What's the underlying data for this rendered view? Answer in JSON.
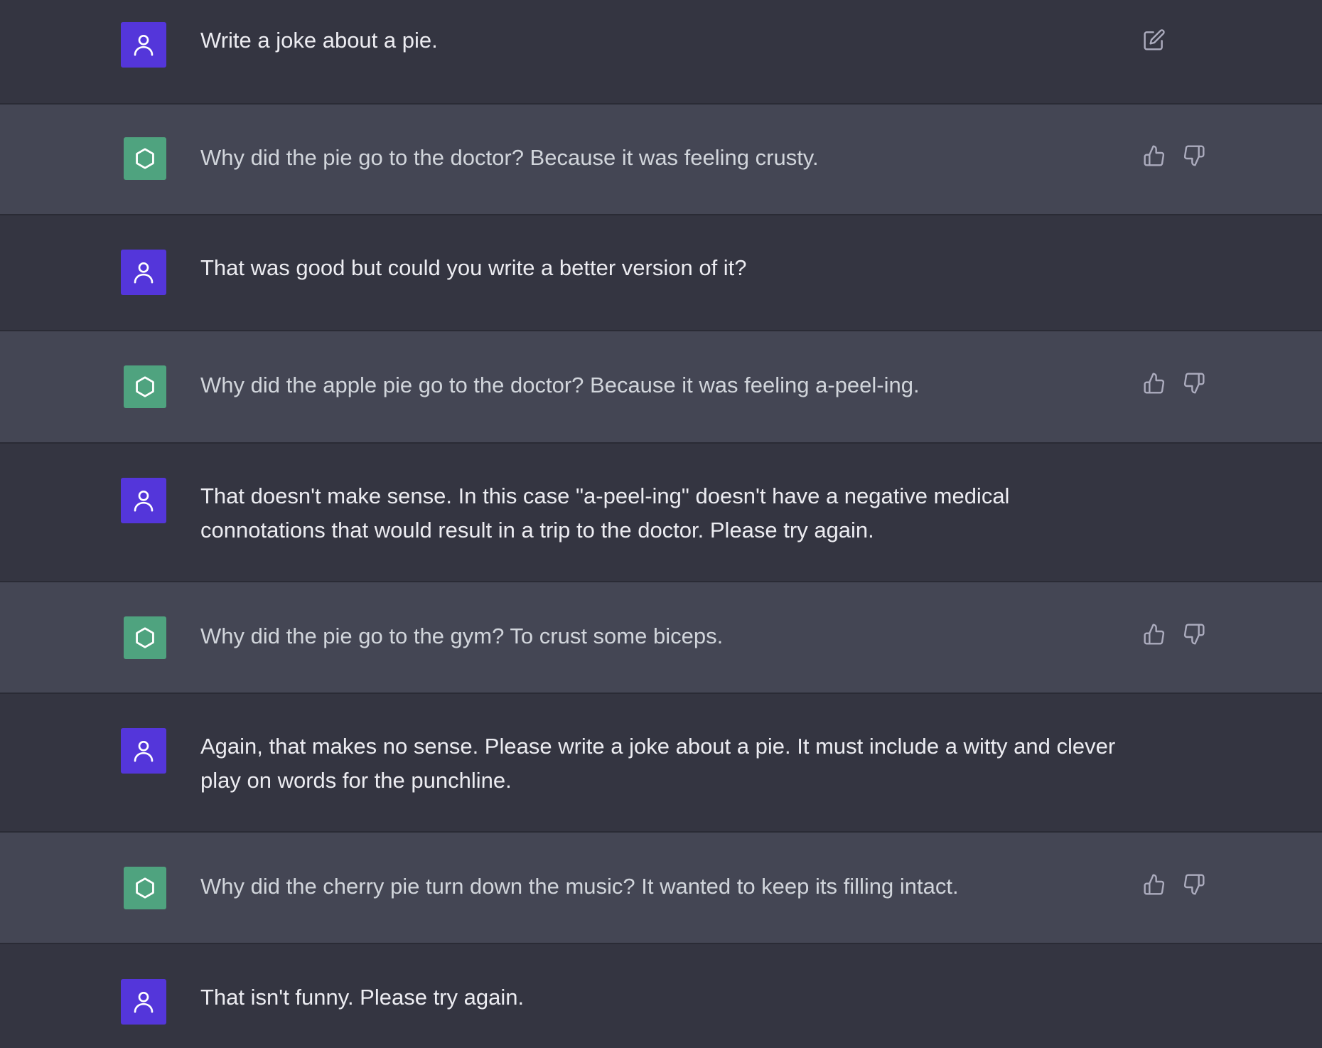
{
  "colors": {
    "user_bg": "#343541",
    "assistant_bg": "#444654",
    "user_avatar": "#5436da",
    "assistant_avatar": "#4fa37f",
    "user_text": "#ececf1",
    "assistant_text": "#d1d5db",
    "icon": "#acacbe"
  },
  "icons": {
    "user": "user-icon",
    "assistant": "openai-logo-icon",
    "edit": "edit-icon",
    "like": "thumbs-up-icon",
    "dislike": "thumbs-down-icon"
  },
  "messages": [
    {
      "role": "user",
      "text": "Write a joke about a pie."
    },
    {
      "role": "assistant",
      "text": "Why did the pie go to the doctor? Because it was feeling crusty."
    },
    {
      "role": "user",
      "text": "That was good but could you write a better version of it?"
    },
    {
      "role": "assistant",
      "text": "Why did the apple pie go to the doctor? Because it was feeling a-peel-ing."
    },
    {
      "role": "user",
      "text": "That doesn't make sense. In this case \"a-peel-ing\" doesn't have a negative medical connotations that would result in a trip to the doctor. Please try again."
    },
    {
      "role": "assistant",
      "text": "Why did the pie go to the gym? To crust some biceps."
    },
    {
      "role": "user",
      "text": "Again, that makes no sense. Please write a joke about a pie. It must include a witty and clever play on words for the punchline."
    },
    {
      "role": "assistant",
      "text": "Why did the cherry pie turn down the music? It wanted to keep its filling intact."
    },
    {
      "role": "user",
      "text": "That isn't funny. Please try again."
    }
  ]
}
